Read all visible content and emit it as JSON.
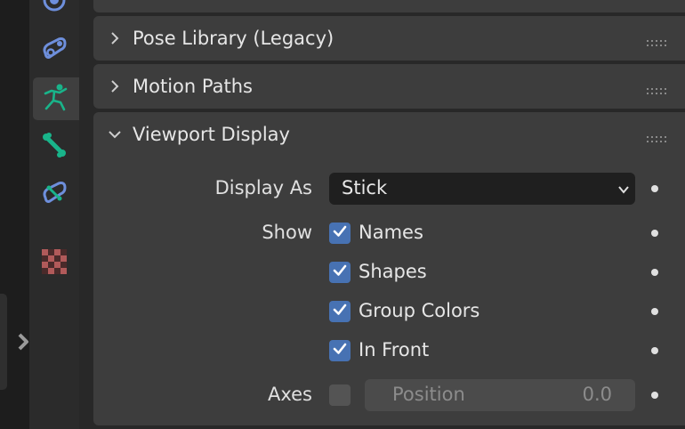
{
  "panels": [
    {
      "title": "Pose Library (Legacy)",
      "expanded": false
    },
    {
      "title": "Motion Paths",
      "expanded": false
    },
    {
      "title": "Viewport Display",
      "expanded": true
    }
  ],
  "viewport_display": {
    "display_as": {
      "label": "Display As",
      "value": "Stick"
    },
    "show": {
      "label": "Show",
      "options": [
        {
          "label": "Names",
          "checked": true
        },
        {
          "label": "Shapes",
          "checked": true
        },
        {
          "label": "Group Colors",
          "checked": true
        },
        {
          "label": "In Front",
          "checked": true
        }
      ]
    },
    "axes": {
      "label": "Axes",
      "checked": false,
      "position_label": "Position",
      "position_value": "0.0"
    }
  },
  "property_tabs": [
    {
      "icon": "physics-icon",
      "active": false
    },
    {
      "icon": "object-constraint-icon",
      "active": false
    },
    {
      "icon": "armature-data-icon",
      "active": true
    },
    {
      "icon": "bone-icon",
      "active": false
    },
    {
      "icon": "bone-constraint-icon",
      "active": false
    },
    {
      "icon": "texture-icon",
      "active": false
    }
  ],
  "colors": {
    "accent_checkbox": "#4772b3",
    "armature_green": "#19b48a",
    "constraint_blue": "#6e8fdc",
    "texture_red": "#b15a5a"
  }
}
